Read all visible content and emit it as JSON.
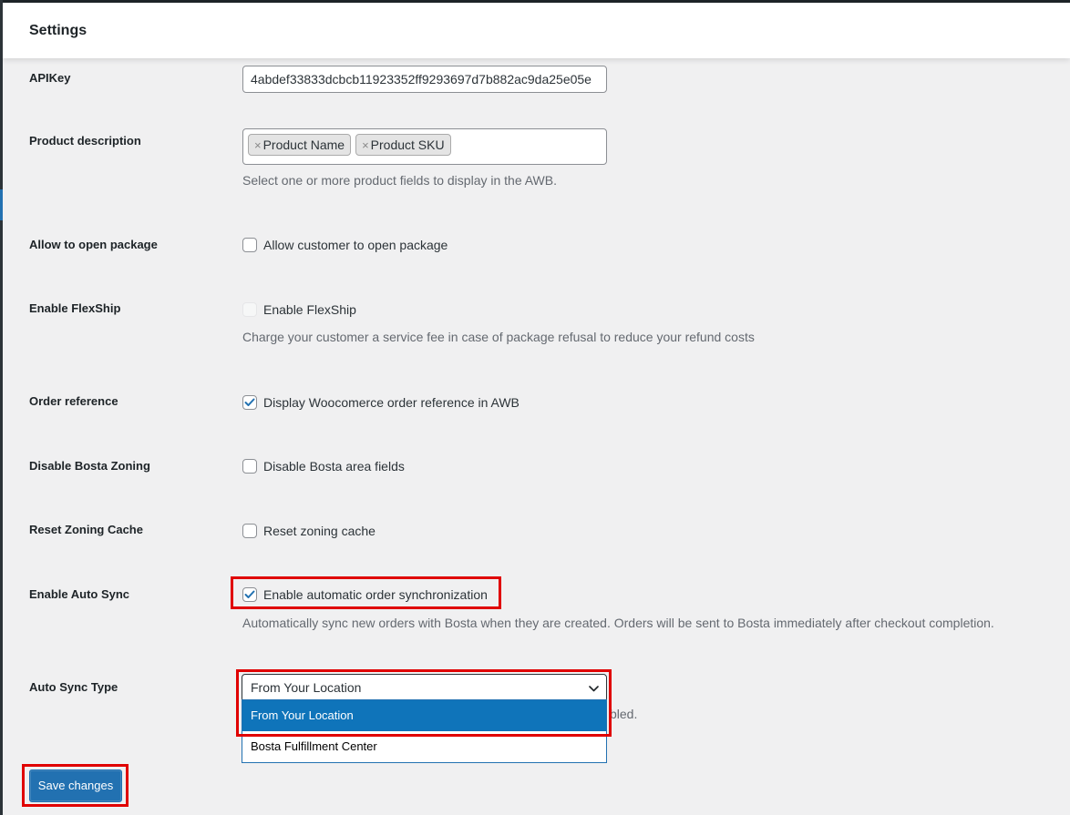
{
  "header": {
    "title": "Settings"
  },
  "fields": {
    "api_key": {
      "label": "APIKey",
      "value": "4abdef33833dcbcb11923352ff9293697d7b882ac9da25e05e"
    },
    "product_description": {
      "label": "Product description",
      "tags": [
        {
          "remove": "×",
          "label": "Product Name"
        },
        {
          "remove": "×",
          "label": "Product SKU"
        }
      ],
      "description": "Select one or more product fields to display in the AWB."
    },
    "allow_open_package": {
      "label": "Allow to open package",
      "checkbox_label": "Allow customer to open package",
      "checked": false,
      "disabled": false
    },
    "enable_flexship": {
      "label": "Enable FlexShip",
      "checkbox_label": "Enable FlexShip",
      "checked": false,
      "disabled": true,
      "description": "Charge your customer a service fee in case of package refusal to reduce your refund costs"
    },
    "order_reference": {
      "label": "Order reference",
      "checkbox_label": "Display Woocomerce order reference in AWB",
      "checked": true,
      "disabled": false
    },
    "disable_bosta_zoning": {
      "label": "Disable Bosta Zoning",
      "checkbox_label": "Disable Bosta area fields",
      "checked": false,
      "disabled": false
    },
    "reset_zoning_cache": {
      "label": "Reset Zoning Cache",
      "checkbox_label": "Reset zoning cache",
      "checked": false,
      "disabled": false
    },
    "enable_auto_sync": {
      "label": "Enable Auto Sync",
      "checkbox_label": "Enable automatic order synchronization",
      "checked": true,
      "disabled": false,
      "description": "Automatically sync new orders with Bosta when they are created. Orders will be sent to Bosta immediately after checkout completion."
    },
    "auto_sync_type": {
      "label": "Auto Sync Type",
      "selected": "From Your Location",
      "options": [
        "From Your Location",
        "Bosta Fulfillment Center"
      ],
      "highlighted_option": "From Your Location",
      "description_fragment": "bled."
    }
  },
  "save_button": {
    "label": "Save changes"
  },
  "colors": {
    "accent": "#2271b1",
    "option_highlight": "#0f74ba",
    "annotation_red": "#e00000",
    "background": "#f0f0f1"
  },
  "icons": {
    "checkbox_check": "checkmark-icon",
    "select_arrow": "chevron-down-icon"
  }
}
